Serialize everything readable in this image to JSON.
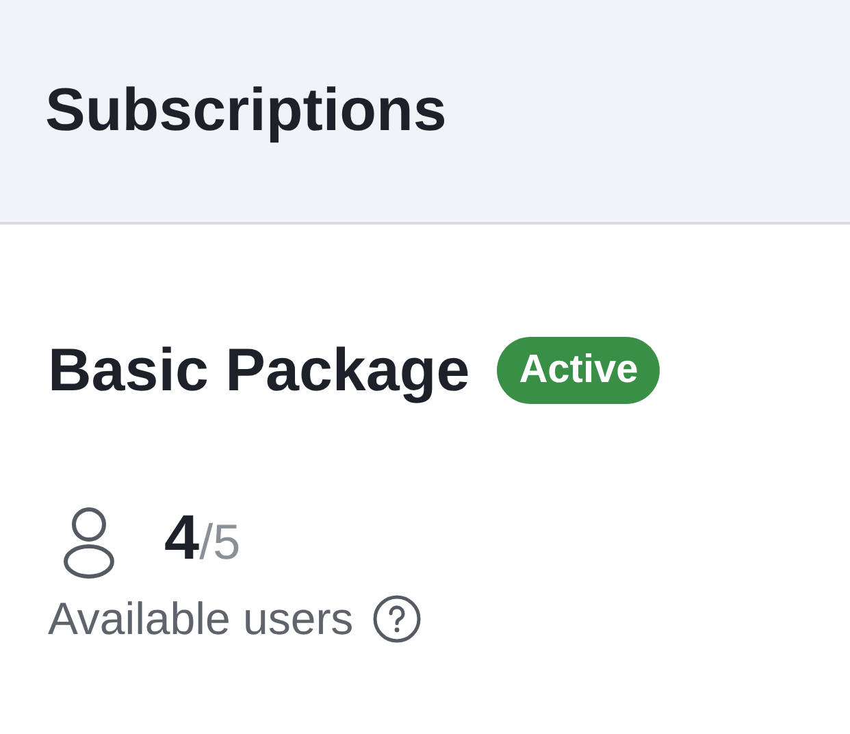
{
  "header": {
    "title": "Subscriptions"
  },
  "package": {
    "name": "Basic Package",
    "status": {
      "label": "Active",
      "kind": "active"
    }
  },
  "users": {
    "used": "4",
    "total": "/5",
    "label": "Available users"
  }
}
